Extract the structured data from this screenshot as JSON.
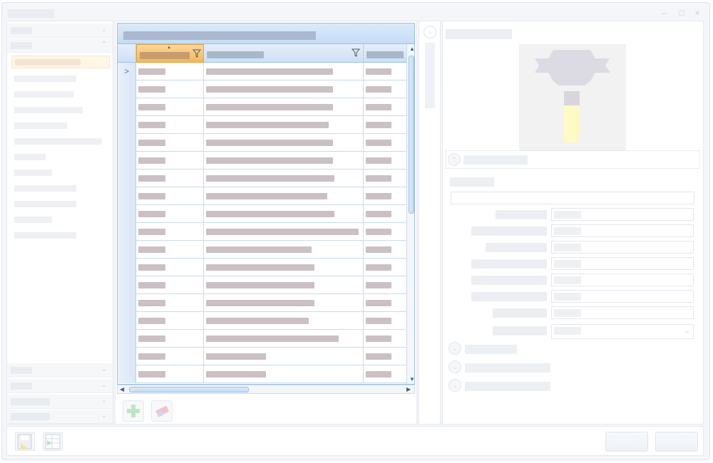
{
  "window": {
    "title": "",
    "controls": [
      "minimize-icon",
      "maximize-icon",
      "close-icon"
    ]
  },
  "left_nav": {
    "groups": [
      "",
      "",
      "",
      "",
      "",
      ""
    ],
    "items": [
      "",
      "",
      "",
      "",
      "",
      "",
      "",
      "",
      "",
      "",
      "",
      ""
    ],
    "selected_index": 0
  },
  "grid": {
    "caption": "",
    "columns": [
      "",
      "",
      ""
    ],
    "sorted_column_index": 0,
    "sort_direction": "ascending",
    "filter_icon": "funnel-icon",
    "current_row_index": 0,
    "row_count": 18,
    "rows": [
      [
        "",
        "",
        ""
      ],
      [
        "",
        "",
        ""
      ],
      [
        "",
        "",
        ""
      ],
      [
        "",
        "",
        ""
      ],
      [
        "",
        "",
        ""
      ],
      [
        "",
        "",
        ""
      ],
      [
        "",
        "",
        ""
      ],
      [
        "",
        "",
        ""
      ],
      [
        "",
        "",
        ""
      ],
      [
        "",
        "",
        ""
      ],
      [
        "",
        "",
        ""
      ],
      [
        "",
        "",
        ""
      ],
      [
        "",
        "",
        ""
      ],
      [
        "",
        "",
        ""
      ],
      [
        "",
        "",
        ""
      ],
      [
        "",
        "",
        ""
      ],
      [
        "",
        "",
        ""
      ],
      [
        "",
        "",
        ""
      ]
    ],
    "toolbar": [
      "add-icon",
      "eraser-icon"
    ]
  },
  "properties": {
    "title": "",
    "preview_icon": "tool-icon",
    "section_expanded": "",
    "group_label": "",
    "wide_field": "",
    "fields": [
      {
        "label": "",
        "value": ""
      },
      {
        "label": "",
        "value": ""
      },
      {
        "label": "",
        "value": ""
      },
      {
        "label": "",
        "value": ""
      },
      {
        "label": "",
        "value": ""
      },
      {
        "label": "",
        "value": ""
      },
      {
        "label": "",
        "value": ""
      },
      {
        "label": "",
        "value": ""
      }
    ],
    "collapsed_sections": [
      "",
      "",
      ""
    ]
  },
  "bottom": {
    "icons": [
      "save-icon",
      "table-export-icon"
    ],
    "buttons": [
      "",
      ""
    ]
  },
  "colors": {
    "accent": "#9bbfe6",
    "header_active": "#f4b85a",
    "selection": "#fff6e6",
    "preview_handle": "#fdfbc5"
  }
}
